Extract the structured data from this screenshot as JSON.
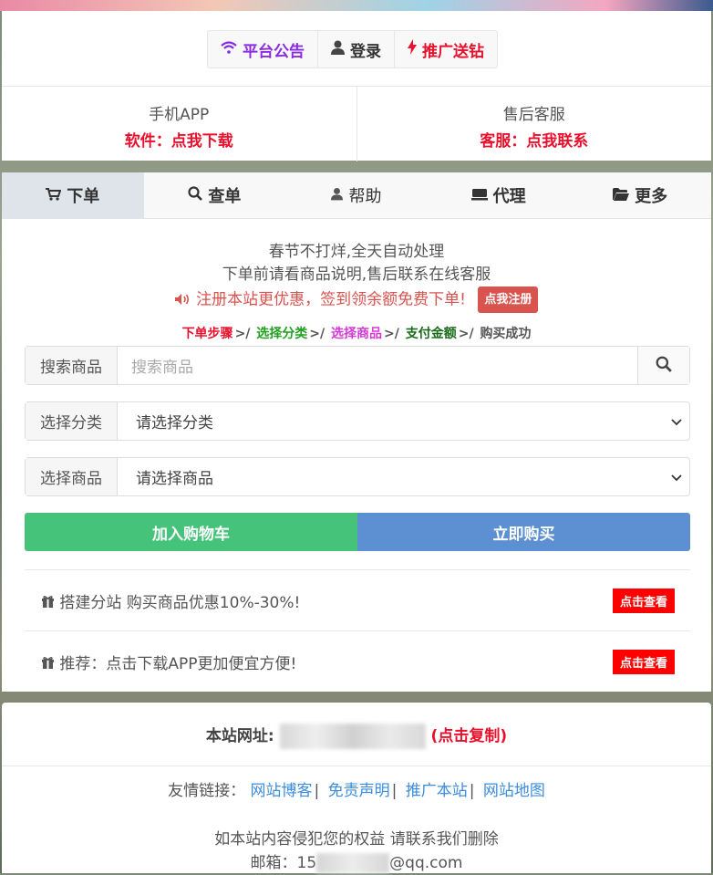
{
  "header": {
    "buttons": [
      {
        "label": "平台公告",
        "icon": "wifi-icon"
      },
      {
        "label": "登录",
        "icon": "user-icon"
      },
      {
        "label": "推广送钻",
        "icon": "bolt-icon"
      }
    ]
  },
  "info": {
    "app": {
      "title": "手机APP",
      "link": "软件：点我下载"
    },
    "service": {
      "title": "售后客服",
      "link": "客服：点我联系"
    }
  },
  "tabs": [
    {
      "label": "下单",
      "icon": "cart-icon",
      "active": true
    },
    {
      "label": "查单",
      "icon": "search-icon"
    },
    {
      "label": "帮助",
      "icon": "user-icon"
    },
    {
      "label": "代理",
      "icon": "keyboard-icon"
    },
    {
      "label": "更多",
      "icon": "folder-icon"
    }
  ],
  "notice": {
    "line1": "春节不打烊,全天自动处理",
    "line2": "下单前请看商品说明,售后联系在线客服",
    "line3": "注册本站更优惠，签到领余额免费下单!",
    "register_btn": "点我注册"
  },
  "steps": [
    "下单步骤",
    "选择分类",
    "选择商品",
    "支付金额",
    "购买成功"
  ],
  "search": {
    "label": "搜索商品",
    "placeholder": "搜索商品"
  },
  "category": {
    "label": "选择分类",
    "value": "请选择分类"
  },
  "product": {
    "label": "选择商品",
    "value": "请选择商品"
  },
  "actions": {
    "cart": "加入购物车",
    "buy": "立即购买"
  },
  "promos": [
    {
      "text": "搭建分站 购买商品优惠10%-30%!",
      "btn": "点击查看"
    },
    {
      "text": "推荐：点击下载APP更加便宜方便!",
      "btn": "点击查看"
    }
  ],
  "footer": {
    "site_label": "本站网址:",
    "copy_label": "(点击复制)",
    "links_label": "友情链接：",
    "links": [
      "网站博客",
      "免责声明",
      "推广本站",
      "网站地图"
    ],
    "notice": "如本站内容侵犯您的权益 请联系我们删除",
    "email_label": "邮箱：",
    "email_prefix": "15",
    "email_suffix": "@qq.com"
  },
  "colors": {
    "green": "#46c37b",
    "blue": "#5c90d2",
    "red": "#e8112d",
    "purple": "#8a2be2"
  }
}
